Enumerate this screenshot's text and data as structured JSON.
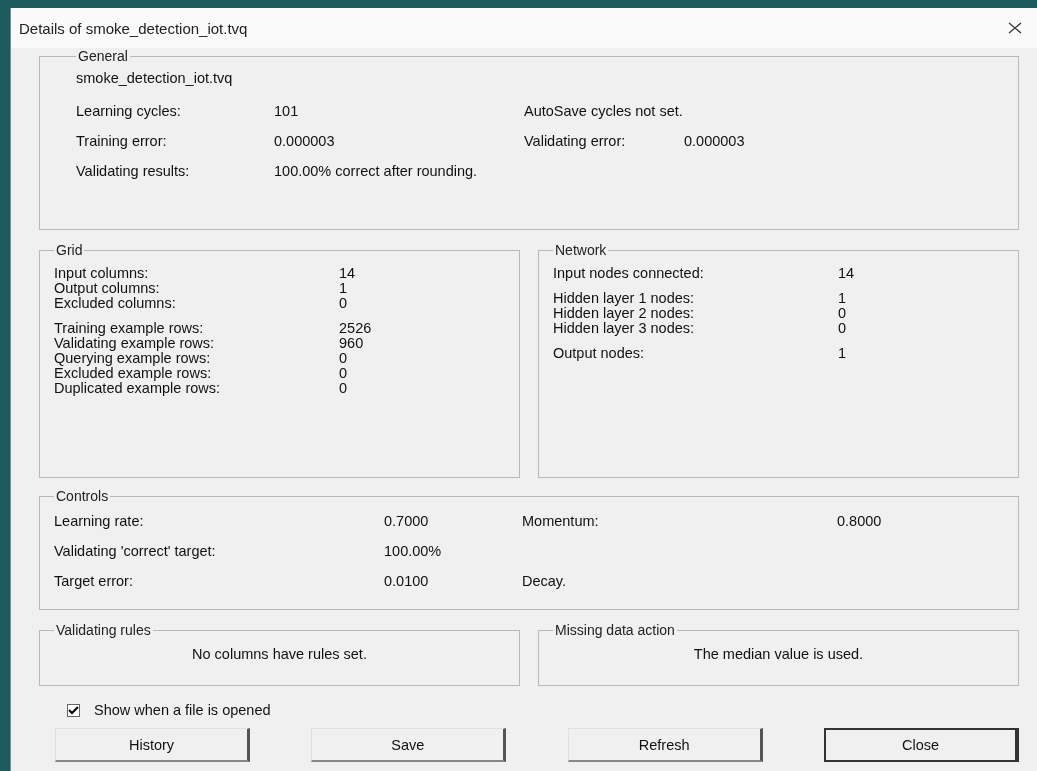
{
  "window": {
    "title": "Details of smoke_detection_iot.tvq"
  },
  "general": {
    "title": "General",
    "filename": "smoke_detection_iot.tvq",
    "learning_cycles": {
      "label": "Learning cycles:",
      "value": "101"
    },
    "autosave": "AutoSave cycles not set.",
    "training_error": {
      "label": "Training error:",
      "value": "0.000003"
    },
    "validating_error": {
      "label": "Validating error:",
      "value": "0.000003"
    },
    "validating_results": {
      "label": "Validating results:",
      "value": "100.00% correct after rounding."
    }
  },
  "grid": {
    "title": "Grid",
    "groups": [
      [
        {
          "label": "Input columns:",
          "value": "14"
        },
        {
          "label": "Output columns:",
          "value": "1"
        },
        {
          "label": "Excluded columns:",
          "value": "0"
        }
      ],
      [
        {
          "label": "Training example rows:",
          "value": "2526"
        },
        {
          "label": "Validating example rows:",
          "value": "960"
        },
        {
          "label": "Querying example rows:",
          "value": "0"
        },
        {
          "label": "Excluded example rows:",
          "value": "0"
        },
        {
          "label": "Duplicated example rows:",
          "value": "0"
        }
      ]
    ]
  },
  "network": {
    "title": "Network",
    "groups": [
      [
        {
          "label": "Input nodes connected:",
          "value": "14"
        }
      ],
      [
        {
          "label": "Hidden layer 1 nodes:",
          "value": "1"
        },
        {
          "label": "Hidden layer 2 nodes:",
          "value": "0"
        },
        {
          "label": "Hidden layer 3 nodes:",
          "value": "0"
        }
      ],
      [
        {
          "label": "Output nodes:",
          "value": "1"
        }
      ]
    ]
  },
  "controls": {
    "title": "Controls",
    "rows": [
      [
        {
          "label": "Learning rate:",
          "value": "0.7000"
        },
        {
          "label": "Momentum:",
          "value": "0.8000"
        }
      ],
      [
        {
          "label": "Validating 'correct' target:",
          "value": "100.00%"
        }
      ],
      [
        {
          "label": "Target error:",
          "value": "0.0100"
        },
        {
          "label": "Decay."
        }
      ]
    ]
  },
  "validating_rules": {
    "title": "Validating rules",
    "text": "No columns have rules set."
  },
  "missing_data_action": {
    "title": "Missing data action",
    "text": "The median value is used."
  },
  "show_on_open": {
    "label": "Show when a file is opened",
    "checked": true
  },
  "buttons": [
    {
      "label": "History",
      "default": false
    },
    {
      "label": "Save",
      "default": false
    },
    {
      "label": "Refresh",
      "default": false
    },
    {
      "label": "Close",
      "default": true
    }
  ]
}
